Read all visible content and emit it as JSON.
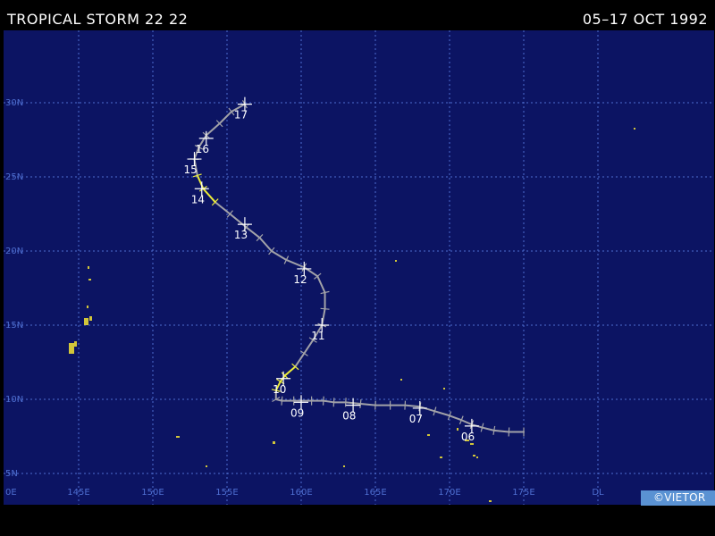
{
  "header": {
    "title": "TROPICAL STORM 22 22",
    "dates": "05–17 OCT 1992"
  },
  "footer": {
    "badge": "©VIETOR"
  },
  "colors": {
    "ocean": "#0c1463",
    "grid": "#4e6ed0",
    "land": "#d2c63a",
    "track_storm": "#a2a2a8",
    "track_intense": "#ecec3a",
    "markers": "#ffffff",
    "badge": "#5a92d3"
  },
  "map": {
    "lat_labels": [
      {
        "lat": 30,
        "text": "30N"
      },
      {
        "lat": 25,
        "text": "25N"
      },
      {
        "lat": 20,
        "text": "20N"
      },
      {
        "lat": 15,
        "text": "15N"
      },
      {
        "lat": 10,
        "text": "10N"
      },
      {
        "lat": 5,
        "text": "5N"
      }
    ],
    "lon_labels": [
      {
        "lon": 140,
        "text": "0E"
      },
      {
        "lon": 145,
        "text": "145E"
      },
      {
        "lon": 150,
        "text": "150E"
      },
      {
        "lon": 155,
        "text": "155E"
      },
      {
        "lon": 160,
        "text": "160E"
      },
      {
        "lon": 165,
        "text": "165E"
      },
      {
        "lon": 170,
        "text": "170E"
      },
      {
        "lon": 175,
        "text": "175E"
      },
      {
        "lon": 180,
        "text": "DL"
      }
    ]
  },
  "track": {
    "points": [
      {
        "lat": 7.8,
        "lon": 175.0,
        "cls": "storm"
      },
      {
        "lat": 7.8,
        "lon": 174.0,
        "cls": "storm"
      },
      {
        "lat": 7.9,
        "lon": 173.0,
        "cls": "storm"
      },
      {
        "lat": 8.1,
        "lon": 172.2,
        "cls": "storm"
      },
      {
        "lat": 8.3,
        "lon": 171.5,
        "cls": "storm"
      },
      {
        "lat": 8.6,
        "lon": 170.8,
        "cls": "storm"
      },
      {
        "lat": 8.9,
        "lon": 170.0,
        "cls": "storm"
      },
      {
        "lat": 9.2,
        "lon": 169.0,
        "cls": "storm"
      },
      {
        "lat": 9.5,
        "lon": 168.0,
        "cls": "storm"
      },
      {
        "lat": 9.6,
        "lon": 167.0,
        "cls": "storm"
      },
      {
        "lat": 9.6,
        "lon": 166.0,
        "cls": "storm"
      },
      {
        "lat": 9.6,
        "lon": 165.0,
        "cls": "storm"
      },
      {
        "lat": 9.7,
        "lon": 164.0,
        "cls": "storm"
      },
      {
        "lat": 9.8,
        "lon": 163.0,
        "cls": "storm"
      },
      {
        "lat": 9.8,
        "lon": 162.2,
        "cls": "storm"
      },
      {
        "lat": 9.9,
        "lon": 161.5,
        "cls": "storm"
      },
      {
        "lat": 9.9,
        "lon": 160.7,
        "cls": "storm"
      },
      {
        "lat": 9.9,
        "lon": 160.0,
        "cls": "storm"
      },
      {
        "lat": 9.9,
        "lon": 159.5,
        "cls": "storm"
      },
      {
        "lat": 9.9,
        "lon": 158.7,
        "cls": "storm"
      },
      {
        "lat": 10.0,
        "lon": 158.3,
        "cls": "storm"
      },
      {
        "lat": 10.6,
        "lon": 158.3,
        "cls": "intense"
      },
      {
        "lat": 11.2,
        "lon": 158.6,
        "cls": "intense"
      },
      {
        "lat": 11.6,
        "lon": 158.9,
        "cls": "intense"
      },
      {
        "lat": 12.2,
        "lon": 159.6,
        "cls": "intense"
      },
      {
        "lat": 13.1,
        "lon": 160.2,
        "cls": "storm"
      },
      {
        "lat": 14.0,
        "lon": 160.8,
        "cls": "storm"
      },
      {
        "lat": 15.0,
        "lon": 161.4,
        "cls": "storm"
      },
      {
        "lat": 16.1,
        "lon": 161.6,
        "cls": "storm"
      },
      {
        "lat": 17.2,
        "lon": 161.6,
        "cls": "storm"
      },
      {
        "lat": 18.3,
        "lon": 161.1,
        "cls": "storm"
      },
      {
        "lat": 18.9,
        "lon": 160.2,
        "cls": "storm"
      },
      {
        "lat": 19.4,
        "lon": 159.0,
        "cls": "storm"
      },
      {
        "lat": 20.0,
        "lon": 158.0,
        "cls": "storm"
      },
      {
        "lat": 20.9,
        "lon": 157.2,
        "cls": "storm"
      },
      {
        "lat": 21.6,
        "lon": 156.3,
        "cls": "storm"
      },
      {
        "lat": 22.5,
        "lon": 155.2,
        "cls": "storm"
      },
      {
        "lat": 23.3,
        "lon": 154.2,
        "cls": "intense"
      },
      {
        "lat": 24.2,
        "lon": 153.4,
        "cls": "intense"
      },
      {
        "lat": 25.1,
        "lon": 153.0,
        "cls": "intense"
      },
      {
        "lat": 26.2,
        "lon": 152.8,
        "cls": "storm"
      },
      {
        "lat": 27.0,
        "lon": 153.1,
        "cls": "storm"
      },
      {
        "lat": 27.8,
        "lon": 153.6,
        "cls": "storm"
      },
      {
        "lat": 28.6,
        "lon": 154.5,
        "cls": "storm"
      },
      {
        "lat": 29.4,
        "lon": 155.3,
        "cls": "storm"
      },
      {
        "lat": 29.9,
        "lon": 156.2,
        "cls": "storm"
      }
    ],
    "day_labels": [
      {
        "text": "06",
        "lat": 8.2,
        "lon": 171.5
      },
      {
        "text": "07",
        "lat": 9.4,
        "lon": 168.0
      },
      {
        "text": "08",
        "lat": 9.6,
        "lon": 163.5
      },
      {
        "text": "09",
        "lat": 9.8,
        "lon": 160.0
      },
      {
        "text": "10",
        "lat": 11.4,
        "lon": 158.8
      },
      {
        "text": "11",
        "lat": 15.0,
        "lon": 161.4
      },
      {
        "text": "12",
        "lat": 18.8,
        "lon": 160.2
      },
      {
        "text": "13",
        "lat": 21.8,
        "lon": 156.2
      },
      {
        "text": "14",
        "lat": 24.2,
        "lon": 153.3
      },
      {
        "text": "15",
        "lat": 26.2,
        "lon": 152.8
      },
      {
        "text": "16",
        "lat": 27.6,
        "lon": 153.6
      },
      {
        "text": "17",
        "lat": 29.9,
        "lon": 156.2
      }
    ]
  }
}
